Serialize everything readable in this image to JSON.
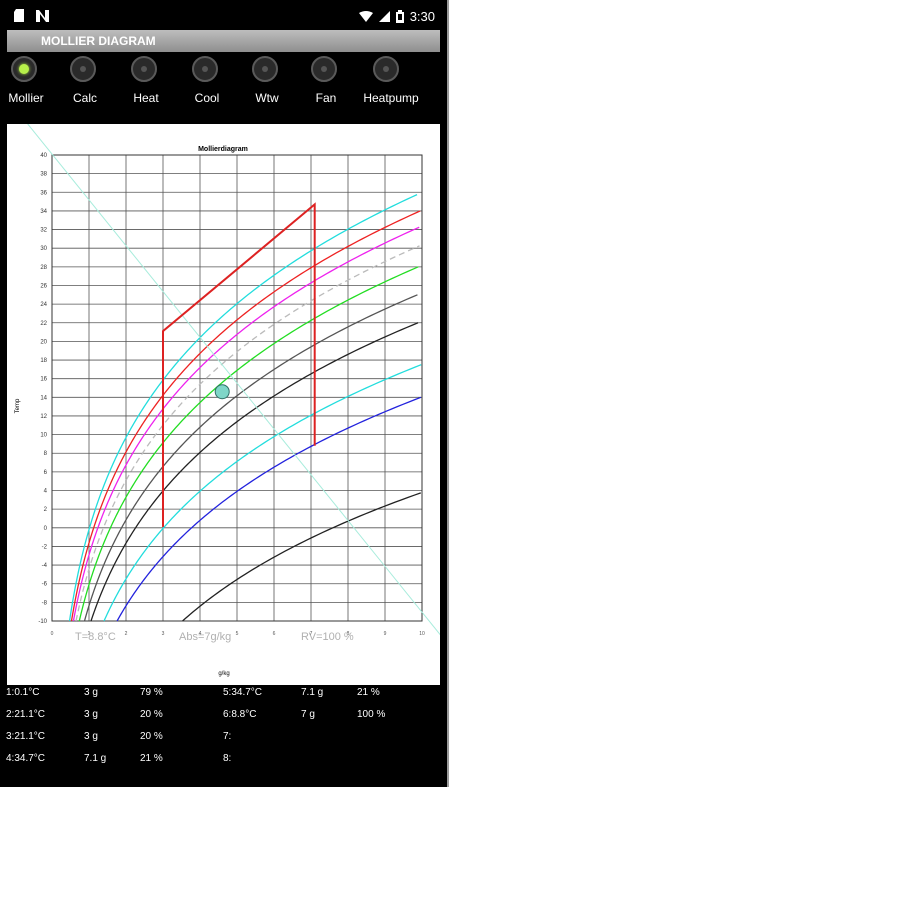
{
  "status_bar": {
    "time": "3:30"
  },
  "app": {
    "title": "MOLLIER DIAGRAM"
  },
  "tabs": [
    {
      "label": "Mollier",
      "selected": true
    },
    {
      "label": "Calc",
      "selected": false
    },
    {
      "label": "Heat",
      "selected": false
    },
    {
      "label": "Cool",
      "selected": false
    },
    {
      "label": "Wtw",
      "selected": false
    },
    {
      "label": "Fan",
      "selected": false
    },
    {
      "label": "Heatpump",
      "selected": false
    }
  ],
  "readout": {
    "temp": "T=8.8°C",
    "abs": "Abs=7g/kg",
    "rv": "RV=100 %"
  },
  "chart_data": {
    "type": "line",
    "title": "Mollierdiagram",
    "xlabel": "g/kg",
    "ylabel": "Temp",
    "xlim": [
      0,
      10
    ],
    "ylim": [
      -10,
      40
    ],
    "x_ticks": [
      0,
      1,
      2,
      3,
      4,
      5,
      6,
      7,
      8,
      9,
      10
    ],
    "x_tick_labels": [
      "0",
      "1",
      "2",
      "3",
      "4",
      "5",
      "6",
      "7",
      "8",
      "9",
      "10"
    ],
    "y_ticks": [
      -10,
      -8,
      -6,
      -4,
      -2,
      0,
      2,
      4,
      6,
      8,
      10,
      12,
      14,
      16,
      18,
      20,
      22,
      24,
      26,
      28,
      30,
      32,
      34,
      36,
      38,
      40
    ],
    "grid": true,
    "rh_curves": [
      {
        "rh": 200,
        "color": "#222222",
        "dashed": false
      },
      {
        "rh": 100,
        "color": "#2222dd",
        "dashed": false
      },
      {
        "rh": 80,
        "color": "#22dddd",
        "dashed": false
      },
      {
        "rh": 60,
        "color": "#222222",
        "dashed": false
      },
      {
        "rh": 50,
        "color": "#555555",
        "dashed": false
      },
      {
        "rh": 42,
        "color": "#22dd22",
        "dashed": false
      },
      {
        "rh": 37,
        "color": "#bbbbbb",
        "dashed": true
      },
      {
        "rh": 33,
        "color": "#ee22ee",
        "dashed": false
      },
      {
        "rh": 30,
        "color": "#ee2222",
        "dashed": false
      },
      {
        "rh": 27,
        "color": "#22dddd",
        "dashed": false
      }
    ],
    "process_line": {
      "color": "#dd2222",
      "points": [
        [
          3,
          0.1
        ],
        [
          3,
          21.1
        ],
        [
          7.1,
          34.7
        ],
        [
          7.1,
          8.8
        ]
      ]
    },
    "diagonal_line": {
      "color": "#a8ecdc",
      "points": [
        [
          -1.2,
          46
        ],
        [
          10.6,
          -12
        ]
      ]
    },
    "marker": {
      "x": 4.6,
      "y": 14.6,
      "color": "#7fd6c8"
    }
  },
  "results": {
    "left": [
      {
        "state": "1:0.1°C",
        "abs": "3 g",
        "rh": "79 %"
      },
      {
        "state": "2:21.1°C",
        "abs": "3 g",
        "rh": "20 %"
      },
      {
        "state": "3:21.1°C",
        "abs": "3 g",
        "rh": "20 %"
      },
      {
        "state": "4:34.7°C",
        "abs": "7.1 g",
        "rh": "21 %"
      }
    ],
    "right": [
      {
        "state": "5:34.7°C",
        "abs": "7.1 g",
        "rh": "21 %"
      },
      {
        "state": "6:8.8°C",
        "abs": "7 g",
        "rh": "100 %"
      },
      {
        "state": "7:",
        "abs": "",
        "rh": ""
      },
      {
        "state": "8:",
        "abs": "",
        "rh": ""
      }
    ]
  }
}
